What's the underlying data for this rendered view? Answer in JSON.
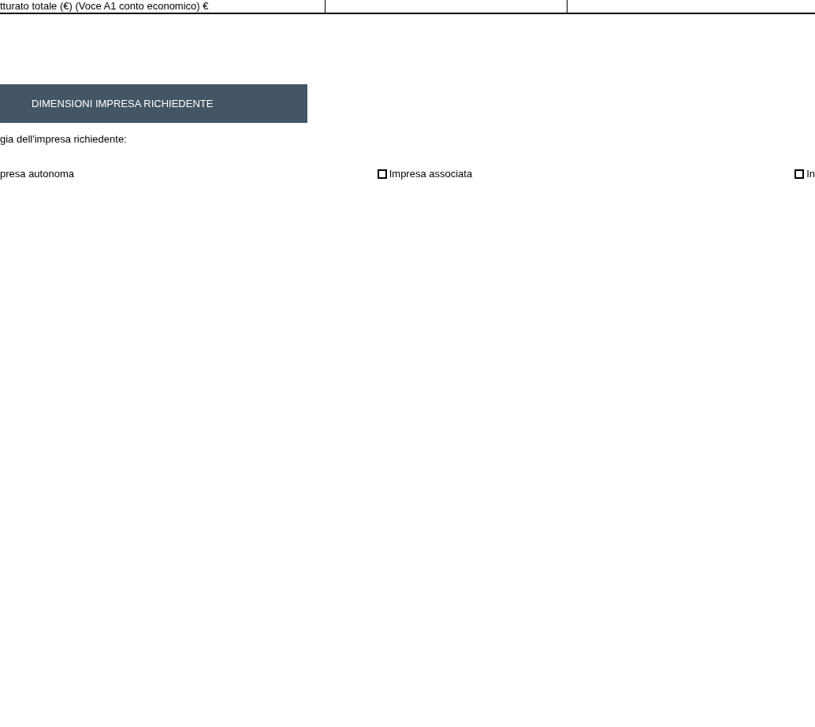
{
  "table": {
    "rows": [
      {
        "cells": [
          "tturato totale (€) (Voce A1 conto economico) €",
          "",
          ""
        ]
      }
    ]
  },
  "section": {
    "title": "DIMENSIONI IMPRESA RICHIEDENTE"
  },
  "question": "gia dell'impresa richiedente:",
  "options": [
    {
      "kind": "label_only",
      "label": "presa autonoma"
    },
    {
      "kind": "checkbox",
      "label": "Impresa associata",
      "checked": false
    },
    {
      "kind": "checkbox",
      "label": "In",
      "checked": false
    }
  ]
}
